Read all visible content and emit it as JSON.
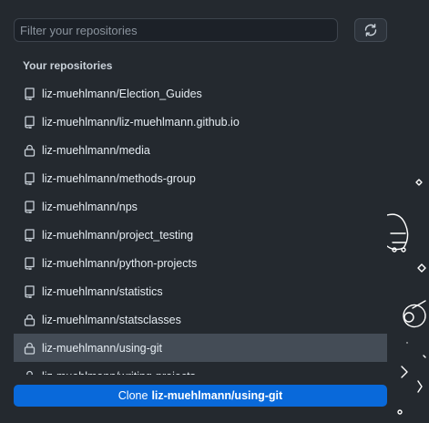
{
  "search": {
    "placeholder": "Filter your repositories",
    "value": ""
  },
  "refresh": {
    "icon": "refresh-icon"
  },
  "section": {
    "title": "Your repositories"
  },
  "repos": [
    {
      "name": "liz-muehlmann/Election_Guides",
      "icon": "repo-icon",
      "private": false
    },
    {
      "name": "liz-muehlmann/liz-muehlmann.github.io",
      "icon": "repo-icon",
      "private": false
    },
    {
      "name": "liz-muehlmann/media",
      "icon": "lock-icon",
      "private": true
    },
    {
      "name": "liz-muehlmann/methods-group",
      "icon": "repo-icon",
      "private": false
    },
    {
      "name": "liz-muehlmann/nps",
      "icon": "repo-icon",
      "private": false
    },
    {
      "name": "liz-muehlmann/project_testing",
      "icon": "repo-icon",
      "private": false
    },
    {
      "name": "liz-muehlmann/python-projects",
      "icon": "repo-icon",
      "private": false
    },
    {
      "name": "liz-muehlmann/statistics",
      "icon": "repo-icon",
      "private": false
    },
    {
      "name": "liz-muehlmann/statsclasses",
      "icon": "lock-icon",
      "private": true
    },
    {
      "name": "liz-muehlmann/using-git",
      "icon": "lock-icon",
      "private": true,
      "selected": true
    },
    {
      "name": "liz-muehlmann/writing-projects",
      "icon": "lock-icon",
      "private": true
    }
  ],
  "clone": {
    "prefix": "Clone",
    "repo": "liz-muehlmann/using-git"
  },
  "colors": {
    "background": "#24292f",
    "accent": "#0969da",
    "selected": "#444c56"
  }
}
